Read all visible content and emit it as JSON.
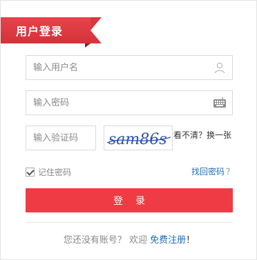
{
  "header": {
    "title": "用户登录"
  },
  "form": {
    "username_placeholder": "输入用户名",
    "password_placeholder": "输入密码",
    "captcha_placeholder": "输入验证码",
    "captcha_text": "sam86s",
    "refresh_label": "看不清？换一张",
    "remember_label": "记住密码",
    "forgot_label": "找回密码",
    "forgot_suffix": "？",
    "login_label": "登录"
  },
  "footer": {
    "prompt": "您还没有账号？ 欢迎",
    "register_label": "免费注册",
    "suffix": "！"
  },
  "colors": {
    "accent": "#ee3b44",
    "link": "#1f6db8"
  }
}
